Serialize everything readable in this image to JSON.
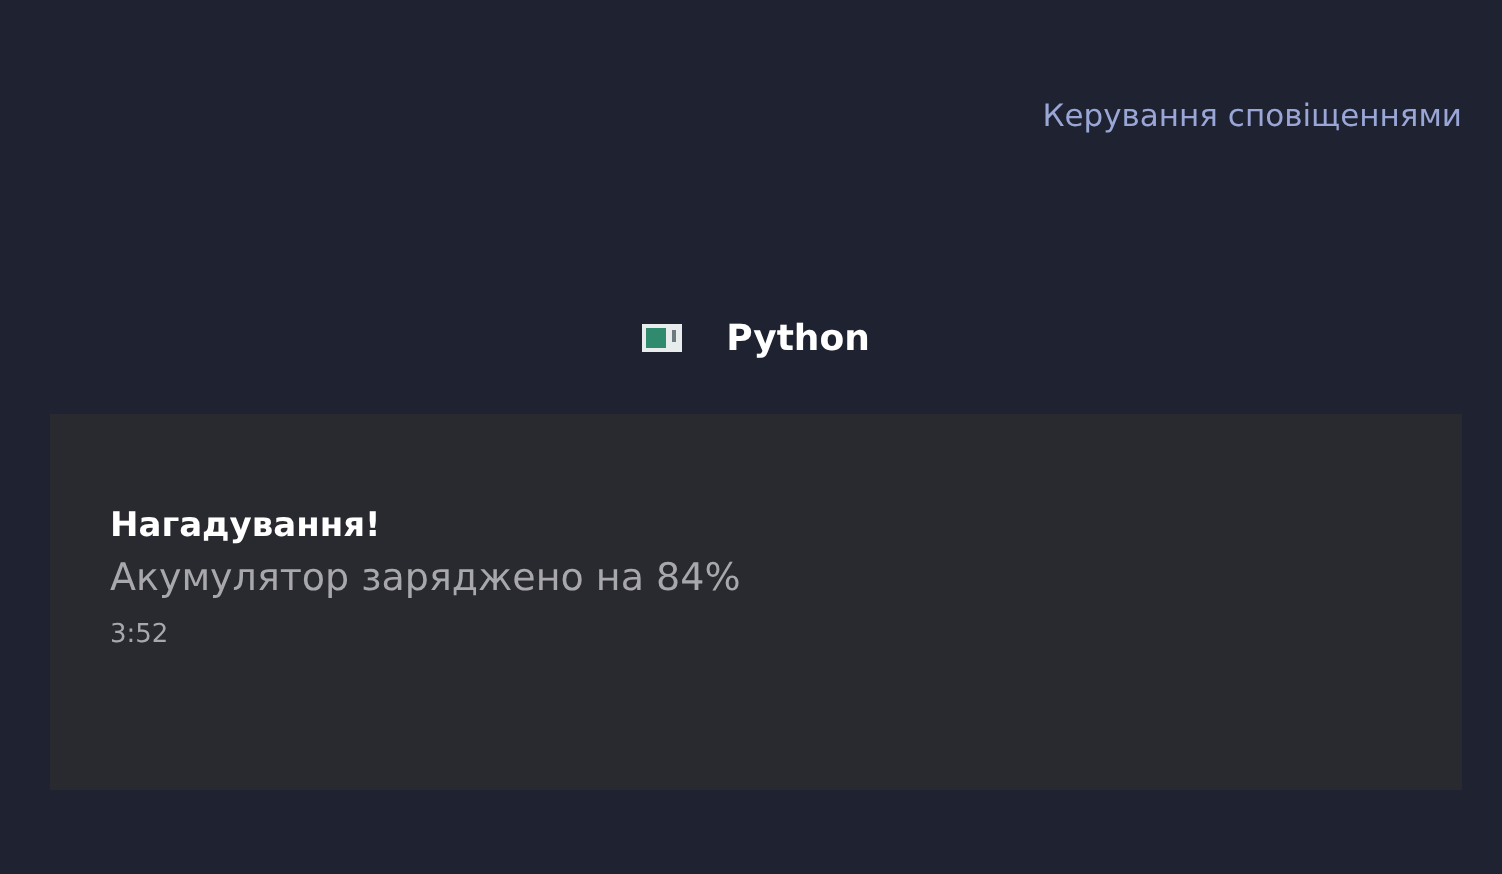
{
  "header": {
    "manage_link": "Керування сповіщеннями"
  },
  "app": {
    "name": "Python"
  },
  "notification": {
    "title": "Нагадування!",
    "body": "Акумулятор заряджено на 84%",
    "time": "3:52"
  }
}
